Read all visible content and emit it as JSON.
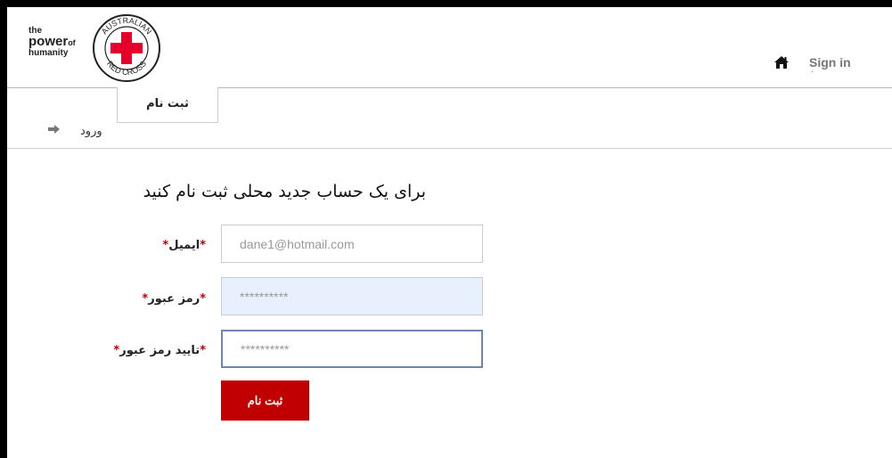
{
  "brand": {
    "tagline_the": "the",
    "tagline_power": "power",
    "tagline_of": "of",
    "tagline_humanity": "humanity",
    "seal_text_top": "AUSTRALIAN",
    "seal_text_bottom": "RED CROSS",
    "color": "#e4002b"
  },
  "header": {
    "signin_label": "Sign in",
    "signin_dot": "·"
  },
  "tabs": {
    "login_label": "ورود",
    "register_label": "ثبت نام"
  },
  "form": {
    "title": "برای یک حساب جدید محلی ثبت نام کنید",
    "email_label": "ایمیل",
    "password_label": "رمز عبور",
    "confirm_label": "تایید رمز عبور",
    "required_mark": "*",
    "email_value": "dane1@hotmail.com",
    "password_value": "**********",
    "confirm_value": "**********",
    "submit_label": "ثبت نام"
  },
  "colors": {
    "accent": "#c00000",
    "autofill_bg": "#e8f0fe",
    "focus_border": "#6f86a8"
  }
}
